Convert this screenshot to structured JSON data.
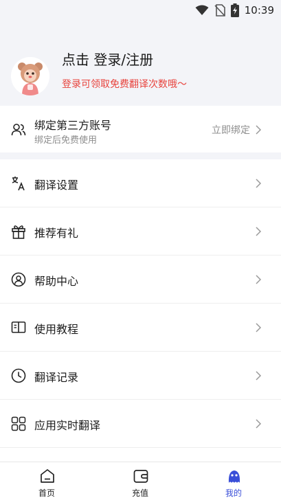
{
  "status_bar": {
    "time": "10:39"
  },
  "profile": {
    "title": "点击 登录/注册",
    "subtitle": "登录可领取免费翻译次数哦～"
  },
  "bind_account": {
    "title": "绑定第三方账号",
    "subtitle": "绑定后免费使用",
    "action": "立即绑定"
  },
  "menu": [
    {
      "label": "翻译设置",
      "icon": "translate-icon"
    },
    {
      "label": "推荐有礼",
      "icon": "gift-icon"
    },
    {
      "label": "帮助中心",
      "icon": "help-icon"
    },
    {
      "label": "使用教程",
      "icon": "book-icon"
    },
    {
      "label": "翻译记录",
      "icon": "clock-icon"
    },
    {
      "label": "应用实时翻译",
      "icon": "apps-icon"
    }
  ],
  "tabs": [
    {
      "label": "首页",
      "icon": "home-icon"
    },
    {
      "label": "充值",
      "icon": "wallet-icon"
    },
    {
      "label": "我的",
      "icon": "profile-icon",
      "active": true
    }
  ],
  "colors": {
    "accent": "#3a4fd8",
    "promo_red": "#e8433d",
    "header_bg": "#f3f4f8"
  }
}
